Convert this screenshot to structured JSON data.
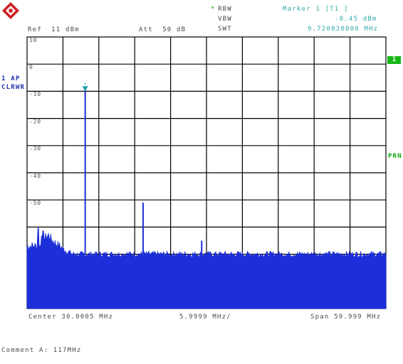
{
  "header": {
    "rbw_star": "*",
    "rbw_label": "RBW",
    "vbw_label": "VBW",
    "swt_label": "SWT",
    "ref_label": "Ref  11 dBm",
    "att_label": "Att  50 dB",
    "marker_title": "Marker 1 [T1 ]",
    "marker_level": "-8.45 dBm",
    "marker_freq": "9.720838000 MHz"
  },
  "side": {
    "trace_mode_1": "1 AP",
    "trace_mode_2": "CLRWR",
    "trace_badge": "1",
    "prn": "PRN"
  },
  "y_ticks": [
    "10",
    "0",
    "-10",
    "-20",
    "-30",
    "-40",
    "-50"
  ],
  "footer": {
    "center": "Center 30.0005 MHz",
    "per_div": "5.9999 MHz/",
    "span": "Span 59.999 MHz",
    "comment": "Comment A: 117MHz"
  },
  "colors": {
    "trace": "#1c2fd8",
    "grid": "#000000",
    "marker": "#1aa0a0",
    "accent": "#18b818"
  },
  "chart_data": {
    "type": "line",
    "title": "",
    "xlabel": "",
    "ylabel": "",
    "x_center_mhz": 30.0005,
    "x_span_mhz": 59.999,
    "x_per_div_mhz": 5.9999,
    "xlim": [
      0.001,
      59.9995
    ],
    "ylim": [
      -89,
      11
    ],
    "y_unit": "dBm",
    "grid": true,
    "noise_floor_dbm": -69,
    "series": [
      {
        "points": [
          [
            0.0,
            -52
          ],
          [
            0.6,
            -55
          ],
          [
            1.2,
            -57
          ],
          [
            1.8,
            -59
          ],
          [
            2.4,
            -61
          ],
          [
            3.0,
            -63
          ],
          [
            3.6,
            -62
          ],
          [
            4.2,
            -64
          ],
          [
            4.8,
            -65
          ],
          [
            5.4,
            -66
          ],
          [
            6.0,
            -67
          ],
          [
            6.6,
            -68
          ],
          [
            7.2,
            -68.5
          ],
          [
            7.8,
            -69
          ],
          [
            8.4,
            -69
          ],
          [
            9.0,
            -69.5
          ],
          [
            9.72,
            -8.45
          ],
          [
            10.2,
            -69
          ],
          [
            12,
            -69
          ],
          [
            14,
            -69.5
          ],
          [
            16,
            -69
          ],
          [
            18,
            -69
          ],
          [
            19.4,
            -50
          ],
          [
            20,
            -69
          ],
          [
            24,
            -69
          ],
          [
            28,
            -69
          ],
          [
            29.2,
            -64
          ],
          [
            30,
            -69
          ],
          [
            36,
            -69
          ],
          [
            42,
            -69
          ],
          [
            48,
            -69
          ],
          [
            54,
            -69
          ],
          [
            60,
            -69
          ]
        ]
      }
    ],
    "markers": [
      {
        "name": "M1",
        "x_mhz": 9.720838,
        "y_dbm": -8.45
      }
    ]
  }
}
